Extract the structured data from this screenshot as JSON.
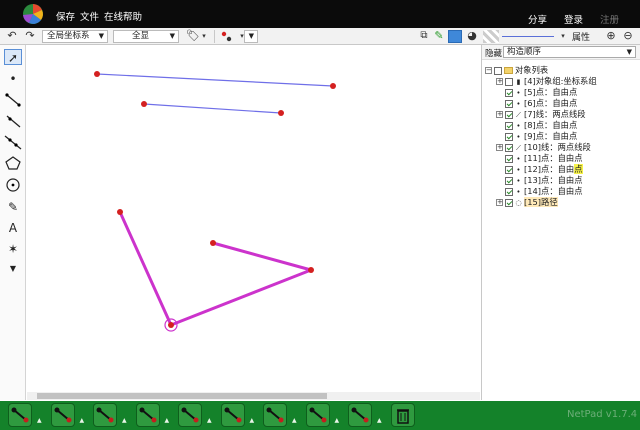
{
  "topbar": {
    "menu": [
      "保存",
      "文件",
      "在线帮助"
    ],
    "share": "分享",
    "login": "登录",
    "register": "注册"
  },
  "toolbar": {
    "coord_system": "全局坐标系",
    "display": "全显",
    "attr_label": "属性"
  },
  "right_panel": {
    "hide_label": "隐藏",
    "order_select": "构造顺序",
    "tree": [
      {
        "label": "对象列表",
        "kind": "folder"
      },
      {
        "label": "[4]对象组:坐标系组",
        "kind": "group",
        "checked": false
      },
      {
        "label": "[5]点：自由点",
        "kind": "point",
        "checked": true
      },
      {
        "label": "[6]点：自由点",
        "kind": "point",
        "checked": true
      },
      {
        "label": "[7]线：两点线段",
        "kind": "segment",
        "checked": true
      },
      {
        "label": "[8]点：自由点",
        "kind": "point",
        "checked": true
      },
      {
        "label": "[9]点：自由点",
        "kind": "point",
        "checked": true
      },
      {
        "label": "[10]线：两点线段",
        "kind": "segment",
        "checked": true
      },
      {
        "label": "[11]点：自由点",
        "kind": "point",
        "checked": true
      },
      {
        "label": "[12]点：自由",
        "label_mark": "点",
        "kind": "point",
        "checked": true
      },
      {
        "label": "[13]点：自由点",
        "kind": "point",
        "checked": true
      },
      {
        "label": "[14]点：自由点",
        "kind": "point",
        "checked": true
      },
      {
        "label": "[15]路径",
        "kind": "path",
        "checked": true,
        "selected": true
      }
    ]
  },
  "canvas": {
    "colors": {
      "segment": "#6f6fe8",
      "path": "#cc33cc",
      "point": "#d42020"
    }
  },
  "version": "NetPad v1.7.4"
}
